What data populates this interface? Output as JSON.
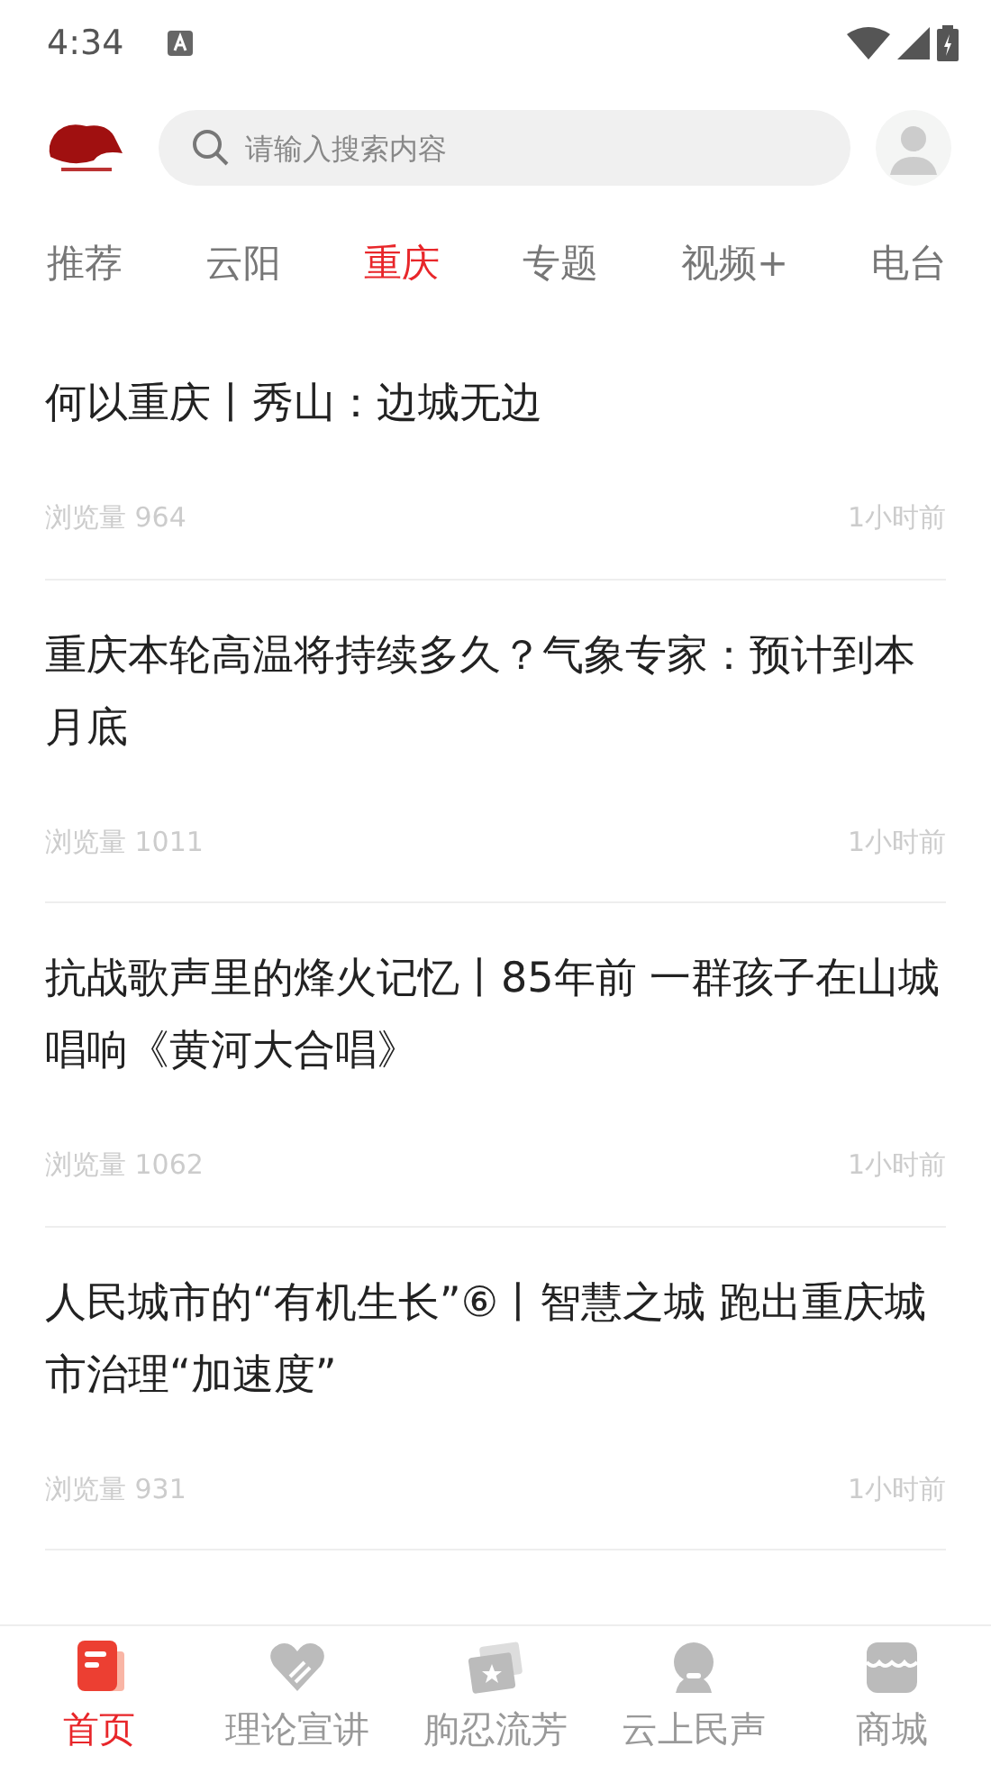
{
  "status_bar": {
    "time": "4:34"
  },
  "search": {
    "placeholder": "请输入搜索内容"
  },
  "tabs": [
    {
      "label": "推荐",
      "selected": false
    },
    {
      "label": "云阳",
      "selected": false
    },
    {
      "label": "重庆",
      "selected": true
    },
    {
      "label": "专题",
      "selected": false
    },
    {
      "label": "视频+",
      "selected": false
    },
    {
      "label": "电台",
      "selected": false
    }
  ],
  "articles": [
    {
      "title": "何以重庆丨秀山：边城无边",
      "views": "浏览量 964",
      "time": "1小时前"
    },
    {
      "title": "重庆本轮高温将持续多久？气象专家：预计到本月底",
      "views": "浏览量 1011",
      "time": "1小时前"
    },
    {
      "title": "抗战歌声里的烽火记忆丨85年前 一群孩子在山城唱响《黄河大合唱》",
      "views": "浏览量 1062",
      "time": "1小时前"
    },
    {
      "title": "人民城市的“有机生长”⑥丨智慧之城 跑出重庆城市治理“加速度”",
      "views": "浏览量 931",
      "time": "1小时前"
    }
  ],
  "bottom_nav": [
    {
      "kind": "home",
      "label": "首页",
      "selected": true
    },
    {
      "kind": "theory",
      "label": "理论宣讲",
      "selected": false
    },
    {
      "kind": "culture",
      "label": "朐忍流芳",
      "selected": false
    },
    {
      "kind": "voice",
      "label": "云上民声",
      "selected": false
    },
    {
      "kind": "shop",
      "label": "商城",
      "selected": false
    }
  ]
}
